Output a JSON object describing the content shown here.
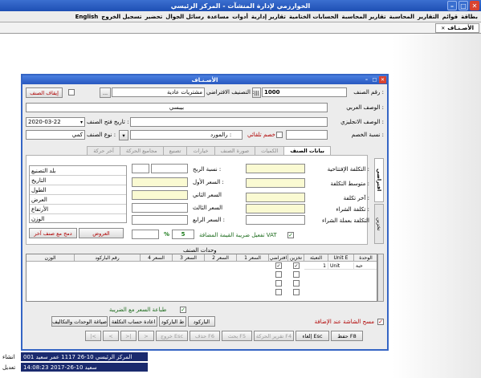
{
  "app": {
    "title": "الخوارزمي لإدارة المنشآت - المركز الرئيسي"
  },
  "menu": {
    "items": [
      "بطاقة",
      "قوائم",
      "التقارير",
      "المحاسبة",
      "تقارير المحاسبة",
      "الحسابات الختامية",
      "تقارير إدارية",
      "أدوات",
      "مساعدة",
      "رسائل الجوال",
      "تحضير",
      "تسجيل الخروج",
      "English"
    ]
  },
  "tabstrip": {
    "active_tab": "الأصـنـاف"
  },
  "dialog": {
    "title": "الأصـنـاف",
    "fields": {
      "item_number_label": "رقم الصنف :",
      "item_number_value": "1000",
      "default_category_label": "التصنيف الافتراضي :",
      "default_category_value": "مشتريات عادية",
      "stop_item_label": "إيقاف الصنف",
      "arabic_desc_label": "الوصف العربي :",
      "arabic_desc_value": "بيبسي",
      "english_desc_label": "الوصف الانجليزي :",
      "open_date_label": "تاريخ فتح الصنف :",
      "open_date_value": "2020-03-22",
      "item_type_label": "نوع الصنف :",
      "item_type_value": "كمي",
      "discount_rate_label": "نسبة الخصم :",
      "supplier_label": "رالمورد :",
      "auto_discount_label": "خصم تلقائي"
    },
    "main_tabs": [
      "بيانات الصنف",
      "الكميات",
      "صورة الصنف",
      "خيارات",
      "تصنيع",
      "مجاميع الحركة",
      "آخر حركة"
    ],
    "side_tabs": [
      "افتراضي",
      "تخزين"
    ],
    "cost": {
      "opening_cost_label": "التكلفة الإفتتاحية :",
      "avg_cost_label": "متوسط التكلفة :",
      "last_cost_label": "آخر تكلفة :",
      "purchase_cost_label": "تكلفة الشراء :",
      "purchase_currency_cost_label": "التكلفة بعملة الشراء"
    },
    "prices": {
      "profit_rate_label": "نسبة الربح :",
      "price1_label": "السعر الأول :",
      "price2_label": "السعر الثاني",
      "price3_label": "السعر الثالث",
      "price4_label": "السعر الرابع :"
    },
    "specs": {
      "labels": [
        "بلد التصنيع",
        "التاريخ",
        "الطول",
        "العرض",
        "الأرتفاع",
        "الوزن"
      ]
    },
    "offers_button": "العروض",
    "merge_button": "دمج مع صنف آخر",
    "vat": {
      "label": "تفعيل ضريبة القيمة المضافة VAT",
      "percent_sign": "%",
      "rate": "5"
    },
    "units_grid": {
      "title": "وحدات الصنف",
      "headers": [
        "الوحدة",
        "Unit E",
        "التعبئة",
        "تخزين",
        "افتراضي",
        "السعر 1",
        "السعر 2",
        "السعر 3",
        "السعر 4",
        "رقم الباركود",
        "الوزن"
      ],
      "rows": [
        {
          "unit": "حبة",
          "unit_e": "Unit",
          "pack": "1"
        }
      ]
    },
    "print_price_tax_label": "طباعة السعر مع الضريبة",
    "clear_screen_label": "مسح الشاشة عند الإضافة",
    "buttons": {
      "barcode": "الباركود",
      "print_barcode": "ط الباركود",
      "recalc_cost": "اعادة حساب التكلفة",
      "units_costs": "صياغة الوحدات والتكاليف",
      "save": "حفظ F8",
      "cancel": "إلغاء Esc",
      "movement_report": "تقرير الحركة F4",
      "search": "بحث F5",
      "delete": "حذف F6",
      "exit": "خروج Esc"
    },
    "status": {
      "created_label": "انشاء",
      "created_value": "001 المركز الرئيسي 10-26 1117 عمر سعيد",
      "modified_label": "تعديل",
      "modified_value": "سعيد 10-26-2017 14:08:23"
    }
  }
}
